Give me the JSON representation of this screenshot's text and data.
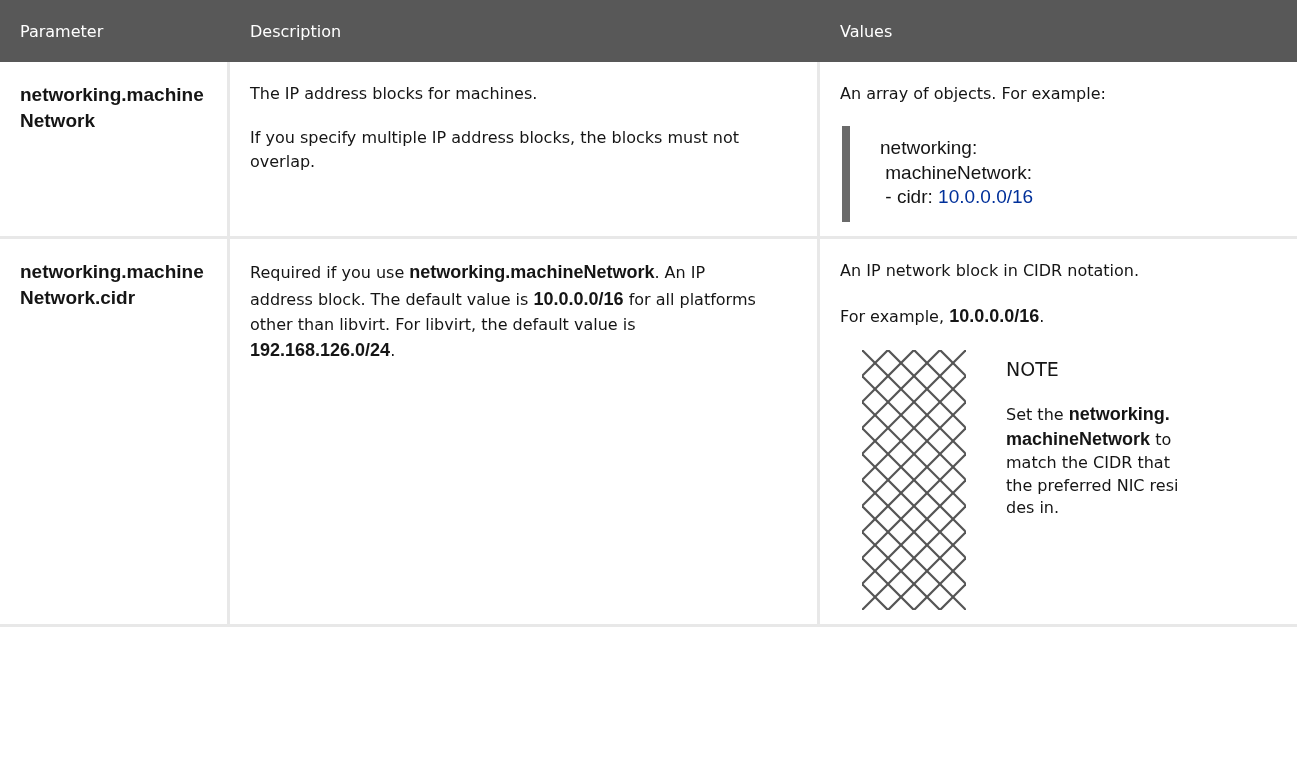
{
  "table": {
    "columns": [
      "Parameter",
      "Description",
      "Values"
    ],
    "rows": [
      {
        "parameter": "networking.machine Network",
        "description": [
          "The IP address blocks for machines.",
          "If you specify multiple IP address blocks, the blocks must not overlap."
        ],
        "values": {
          "text": "An array of objects. For example:",
          "code": [
            {
              "text": "networking:"
            },
            {
              "text": " machineNetwork:"
            },
            {
              "text": " - cidr: ",
              "value": "10.0.0.0/16"
            }
          ]
        }
      },
      {
        "parameter": "networking.machine Network.cidr",
        "description": [
          "Required if you use **networking.machineNetwork**. An IP address block. The default value is **10.0.0.0/16** for all platforms other than libvirt. For libvirt, the default value is **192.168.126.0/24**."
        ],
        "values": {
          "text": "An IP network block in CIDR notation.",
          "example": "For example, **10.0.0.0/16**.",
          "note": {
            "title": "NOTE",
            "text": "Set the **networking.machineNetwork** to match the CIDR that the preferred NIC resides in."
          }
        }
      }
    ]
  }
}
